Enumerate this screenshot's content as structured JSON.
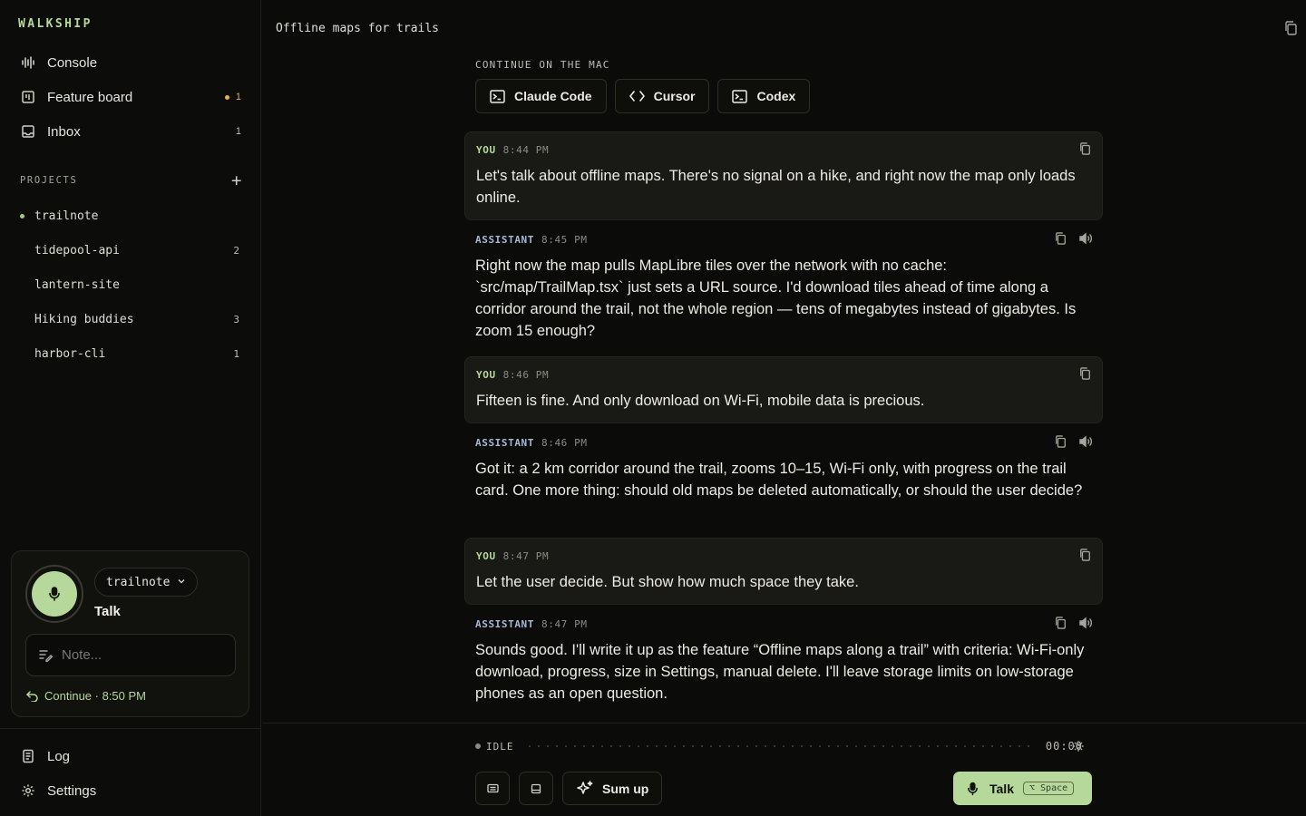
{
  "sidebar": {
    "brand": "WALKSHIP",
    "nav": [
      {
        "label": "Console",
        "icon": "waveform-icon"
      },
      {
        "label": "Feature board",
        "icon": "board-icon",
        "count": "1"
      },
      {
        "label": "Inbox",
        "icon": "inbox-icon",
        "count": "1"
      }
    ],
    "projects_label": "PROJECTS",
    "projects": [
      {
        "name": "trailnote",
        "active": true
      },
      {
        "name": "tidepool-api",
        "count": "2"
      },
      {
        "name": "lantern-site"
      },
      {
        "name": "Hiking buddies",
        "count": "3"
      },
      {
        "name": "harbor-cli",
        "count": "1"
      }
    ],
    "talk_card": {
      "project": "trailnote",
      "talk_label": "Talk",
      "note_placeholder": "Note...",
      "continue": "Continue · 8:50 PM"
    },
    "footer": [
      {
        "label": "Log",
        "icon": "log-icon"
      },
      {
        "label": "Settings",
        "icon": "gear-icon"
      }
    ]
  },
  "main": {
    "title": "Offline maps for trails",
    "continue_label": "CONTINUE ON THE MAC",
    "ide_buttons": [
      "Claude Code",
      "Cursor",
      "Codex"
    ],
    "messages": [
      {
        "role": "YOU",
        "time": "8:44 PM",
        "text": "Let's talk about offline maps. There's no signal on a hike, and right now the map only loads online."
      },
      {
        "role": "ASSISTANT",
        "time": "8:45 PM",
        "text": "Right now the map pulls MapLibre tiles over the network with no cache: `src/map/TrailMap.tsx` just sets a URL source. I'd download tiles ahead of time along a corridor around the trail, not the whole region — tens of megabytes instead of gigabytes. Is zoom 15 enough?"
      },
      {
        "role": "YOU",
        "time": "8:46 PM",
        "text": "Fifteen is fine. And only download on Wi-Fi, mobile data is precious."
      },
      {
        "role": "ASSISTANT",
        "time": "8:46 PM",
        "text": "Got it: a 2 km corridor around the trail, zooms 10–15, Wi-Fi only, with progress on the trail card. One more thing: should old maps be deleted automatically, or should the user decide?"
      },
      {
        "role": "YOU",
        "time": "8:47 PM",
        "text": "Let the user decide. But show how much space they take."
      },
      {
        "role": "ASSISTANT",
        "time": "8:47 PM",
        "text": "Sounds good. I'll write it up as the feature “Offline maps along a trail” with criteria: Wi-Fi-only download, progress, size in Settings, manual delete. I'll leave storage limits on low-storage phones as an open question."
      }
    ],
    "status": {
      "state": "IDLE",
      "timer": "00:00"
    },
    "bottom": {
      "sumup": "Sum up",
      "talk": "Talk",
      "talk_shortcut": "⌥ Space"
    }
  },
  "colors": {
    "accent": "#b6d89a",
    "amber": "#e9b04e",
    "assistant": "#a6b8d8",
    "background": "#0b0b09"
  }
}
